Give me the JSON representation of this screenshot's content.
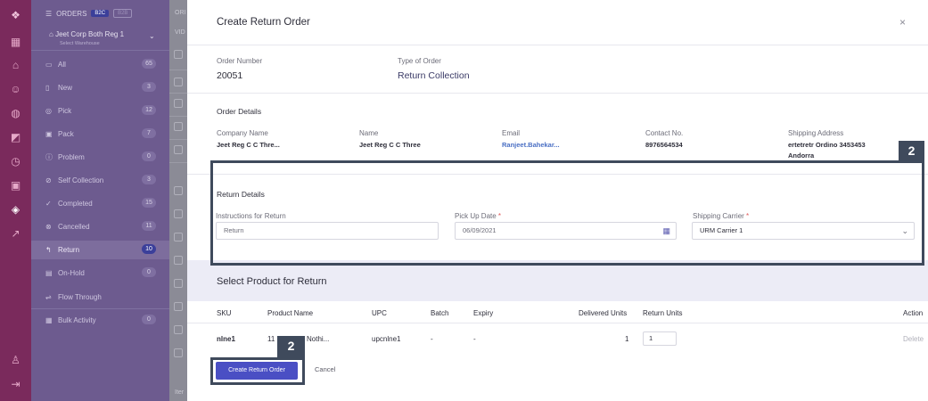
{
  "rail": {
    "icons": [
      "logo-icon",
      "grid-icon",
      "home-icon",
      "users-icon",
      "globe-icon",
      "chart-icon",
      "clock-icon",
      "truck-icon",
      "layers-icon",
      "export-icon",
      "user-icon",
      "logout-icon"
    ]
  },
  "sidebar": {
    "header": "ORDERS",
    "toggle_on": "B2C",
    "toggle_off": "B2B",
    "warehouse_name": "Jeet Corp Both Reg 1",
    "warehouse_sub": "Select Warehouse",
    "items": [
      {
        "label": "All",
        "count": "65"
      },
      {
        "label": "New",
        "count": "3"
      },
      {
        "label": "Pick",
        "count": "12"
      },
      {
        "label": "Pack",
        "count": "7"
      },
      {
        "label": "Problem",
        "count": "0"
      },
      {
        "label": "Self Collection",
        "count": "3"
      },
      {
        "label": "Completed",
        "count": "15"
      },
      {
        "label": "Cancelled",
        "count": "11"
      },
      {
        "label": "Return",
        "count": "10"
      },
      {
        "label": "On-Hold",
        "count": "0"
      },
      {
        "label": "Flow Through",
        "count": ""
      },
      {
        "label": "Bulk Activity",
        "count": "0"
      }
    ]
  },
  "behind": {
    "col1": "ORI",
    "col2": "VID",
    "footer": "Iter"
  },
  "modal": {
    "title": "Create Return Order",
    "close": "×",
    "order_number_label": "Order Number",
    "order_number": "20051",
    "type_label": "Type of Order",
    "type_value": "Return Collection",
    "order_details_title": "Order Details",
    "details": {
      "company_label": "Company Name",
      "company": "Jeet Reg C C Thre...",
      "name_label": "Name",
      "name": "Jeet Reg C C Three",
      "email_label": "Email",
      "email": "Ranjeet.Bahekar...",
      "contact_label": "Contact No.",
      "contact": "8976564534",
      "address_label": "Shipping Address",
      "address_line1": "ertetretr Ordino 3453453",
      "address_line2": "Andorra"
    },
    "return_details_title": "Return Details",
    "instructions_label": "Instructions for Return",
    "instructions_value": "Return",
    "pickup_label": "Pick Up Date",
    "pickup_value": "06/09/2021",
    "carrier_label": "Shipping Carrier",
    "carrier_value": "URM Carrier 1",
    "required_mark": "*",
    "select_product_title": "Select Product for Return",
    "table": {
      "headers": [
        "SKU",
        "Product Name",
        "UPC",
        "Batch",
        "Expiry",
        "Delivered Units",
        "Return Units",
        "Action"
      ],
      "row": {
        "sku": "nlne1",
        "product": "11",
        "product_tail": "Nothi...",
        "upc": "upcnlne1",
        "batch": "-",
        "expiry": "-",
        "delivered": "1",
        "return_units": "1",
        "action": "Delete"
      }
    },
    "create_button": "Create Return Order",
    "cancel_button": "Cancel"
  },
  "annotations": {
    "badge1": "2",
    "badge2": "2"
  },
  "colors": {
    "rail": "#7a2a5c",
    "sidebar": "#6d5b8f",
    "primary": "#4a4fc4",
    "annotation": "#3f4a5c"
  }
}
